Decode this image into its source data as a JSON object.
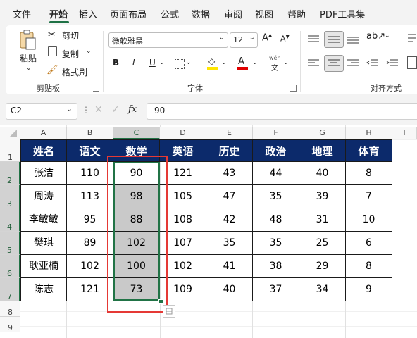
{
  "menu": {
    "items": [
      "文件",
      "开始",
      "插入",
      "页面布局",
      "公式",
      "数据",
      "审阅",
      "视图",
      "帮助",
      "PDF工具集"
    ],
    "active": "开始"
  },
  "ribbon": {
    "clipboard": {
      "paste": "粘贴",
      "cut": "剪切",
      "copy": "复制",
      "format_painter": "格式刷",
      "group_label": "剪贴板"
    },
    "font": {
      "font_name": "微软雅黑",
      "font_size": "12",
      "bold": "B",
      "italic": "I",
      "underline": "U",
      "group_label": "字体",
      "wen_label": "wén",
      "wen_char": "文"
    },
    "alignment": {
      "group_label": "对齐方式"
    }
  },
  "formula_bar": {
    "name_box": "C2",
    "fx_label": "fx",
    "value": "90"
  },
  "columns": [
    "A",
    "B",
    "C",
    "D",
    "E",
    "F",
    "G",
    "H",
    "I"
  ],
  "rows": [
    "1",
    "2",
    "3",
    "4",
    "5",
    "6",
    "7",
    "8",
    "9"
  ],
  "table": {
    "headers": [
      "姓名",
      "语文",
      "数学",
      "英语",
      "历史",
      "政治",
      "地理",
      "体育"
    ],
    "rows": [
      [
        "张洁",
        "110",
        "90",
        "121",
        "43",
        "44",
        "40",
        "8"
      ],
      [
        "周涛",
        "113",
        "98",
        "105",
        "47",
        "35",
        "39",
        "7"
      ],
      [
        "李敏敏",
        "95",
        "88",
        "108",
        "42",
        "48",
        "31",
        "10"
      ],
      [
        "樊琪",
        "89",
        "102",
        "107",
        "35",
        "35",
        "25",
        "6"
      ],
      [
        "耿亚楠",
        "102",
        "100",
        "102",
        "41",
        "38",
        "29",
        "8"
      ],
      [
        "陈志",
        "121",
        "73",
        "109",
        "40",
        "37",
        "34",
        "9"
      ]
    ]
  },
  "colors": {
    "header_fill": "#0c2a6b",
    "selection_fill": "#c9c9c9",
    "selection_border": "#217346",
    "highlight_outline": "#e53935",
    "accent": "#1e7145"
  }
}
